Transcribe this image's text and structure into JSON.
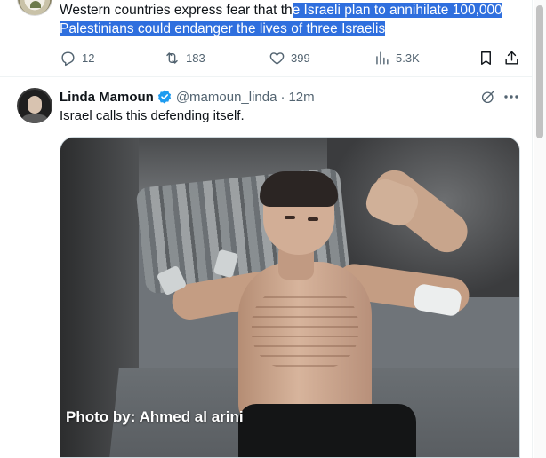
{
  "top_tweet": {
    "text_before_highlight": "Western countries express fear that th",
    "text_highlighted": "e Israeli plan to annihilate 100,000 Palestinians could endanger the lives of three Israelis",
    "actions": {
      "replies": "12",
      "retweets": "183",
      "likes": "399",
      "views": "5.3K"
    }
  },
  "tweet": {
    "display_name": "Linda Mamoun",
    "handle": "@mamoun_linda",
    "separator": "·",
    "time": "12m",
    "text": "Israel calls this defending itself.",
    "media": {
      "photo_credit": "Photo by: Ahmed al arini"
    }
  },
  "colors": {
    "text_primary": "#0f1419",
    "text_secondary": "#536471",
    "verified_blue": "#1d9bf0",
    "selection_highlight": "#2f6fde"
  },
  "icons": [
    "reply-icon",
    "retweet-icon",
    "like-icon",
    "views-icon",
    "bookmark-icon",
    "share-icon",
    "verified-icon",
    "grok-icon",
    "more-icon"
  ]
}
